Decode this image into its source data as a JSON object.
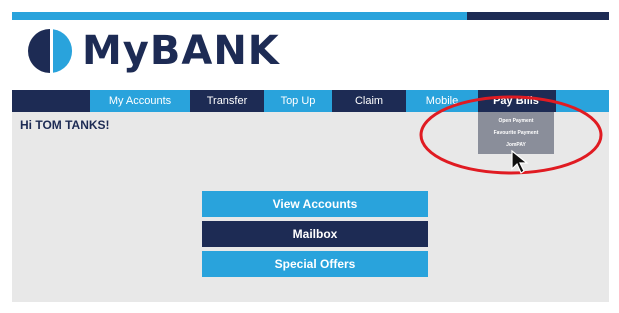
{
  "brand": {
    "name": "MyBANK",
    "color_dark": "#1d2b54",
    "color_light": "#29a3dc"
  },
  "nav": {
    "items": [
      {
        "label": "My Accounts"
      },
      {
        "label": "Transfer"
      },
      {
        "label": "Top Up"
      },
      {
        "label": "Claim"
      },
      {
        "label": "Mobile"
      },
      {
        "label": "Pay Bills"
      }
    ]
  },
  "pay_bills_menu": {
    "items": [
      {
        "label": "Open Payment"
      },
      {
        "label": "Favourite Payment"
      },
      {
        "label": "JomPAY"
      }
    ]
  },
  "greeting": "Hi TOM TANKS!",
  "actions": {
    "view_accounts": "View Accounts",
    "mailbox": "Mailbox",
    "special_offers": "Special Offers"
  },
  "annotation": {
    "color": "#e01b22"
  },
  "icons": {
    "logo_mark": "half-circle-logo-icon",
    "cursor": "mouse-pointer-icon"
  }
}
